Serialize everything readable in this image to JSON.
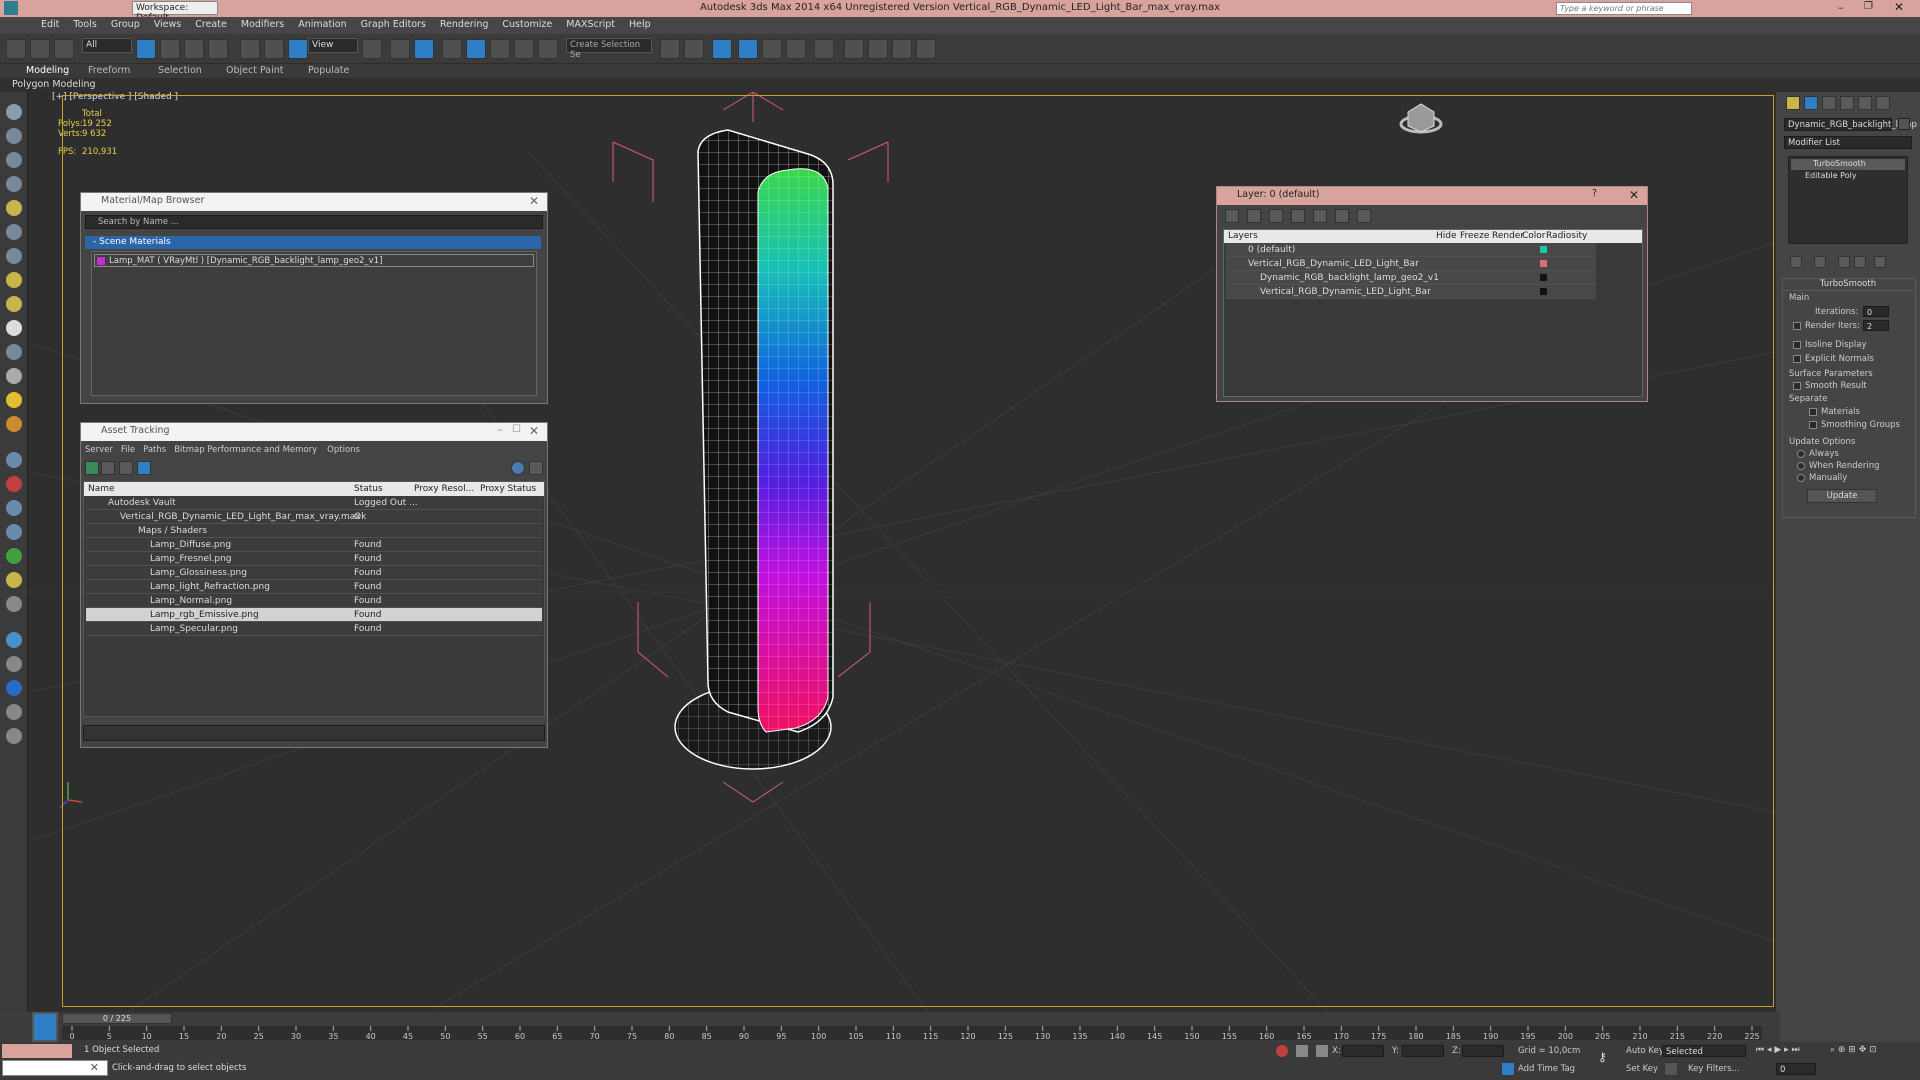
{
  "title": "Autodesk 3ds Max  2014 x64    Unregistered Version    Vertical_RGB_Dynamic_LED_Light_Bar_max_vray.max",
  "quickaccess": {
    "workspace": "Workspace: Default",
    "search_placeholder": "Type a keyword or phrase"
  },
  "menu": [
    "Edit",
    "Tools",
    "Group",
    "Views",
    "Create",
    "Modifiers",
    "Animation",
    "Graph Editors",
    "Rendering",
    "Customize",
    "MAXScript",
    "Help"
  ],
  "toolbar": {
    "filter": "All",
    "refcoord": "View",
    "selset": "Create Selection Se"
  },
  "ribbon": {
    "tabs": [
      "Modeling",
      "Freeform",
      "Selection",
      "Object Paint",
      "Populate"
    ],
    "sub": "Polygon Modeling"
  },
  "viewport": {
    "label": "[+] [Perspective ] [Shaded ]",
    "stats": {
      "total": "Total",
      "polys_label": "Polys:",
      "polys": "19 252",
      "verts_label": "Verts:",
      "verts": "9 632",
      "fps_label": "FPS:",
      "fps": "210,931"
    }
  },
  "material_browser": {
    "title": "Material/Map Browser",
    "search": "Search by Name ...",
    "group": "- Scene Materials",
    "item": "Lamp_MAT  ( VRayMtl )  [Dynamic_RGB_backlight_lamp_geo2_v1]"
  },
  "asset_tracking": {
    "title": "Asset Tracking",
    "menu": [
      "Server",
      "File",
      "Paths",
      "Bitmap Performance and Memory",
      "Options"
    ],
    "columns": [
      "Name",
      "Status",
      "Proxy Resol...",
      "Proxy Status"
    ],
    "rows": [
      {
        "name": "Autodesk Vault",
        "status": "Logged Out ..."
      },
      {
        "name": "Vertical_RGB_Dynamic_LED_Light_Bar_max_vray.max",
        "status": "Ok"
      },
      {
        "name": "Maps / Shaders",
        "status": ""
      },
      {
        "name": "Lamp_Diffuse.png",
        "status": "Found"
      },
      {
        "name": "Lamp_Fresnel.png",
        "status": "Found"
      },
      {
        "name": "Lamp_Glossiness.png",
        "status": "Found"
      },
      {
        "name": "Lamp_light_Refraction.png",
        "status": "Found"
      },
      {
        "name": "Lamp_Normal.png",
        "status": "Found"
      },
      {
        "name": "Lamp_rgb_Emissive.png",
        "status": "Found"
      },
      {
        "name": "Lamp_Specular.png",
        "status": "Found"
      }
    ]
  },
  "layers": {
    "title": "Layer: 0 (default)",
    "columns": [
      "Layers",
      "Hide",
      "Freeze",
      "Render",
      "Color",
      "Radiosity"
    ],
    "rows": [
      {
        "name": "0 (default)",
        "color": "#1fc7a8"
      },
      {
        "name": "Vertical_RGB_Dynamic_LED_Light_Bar",
        "color": "#e06a7a"
      },
      {
        "name": "Dynamic_RGB_backlight_lamp_geo2_v1",
        "color": "#111111"
      },
      {
        "name": "Vertical_RGB_Dynamic_LED_Light_Bar",
        "color": "#111111"
      }
    ]
  },
  "cmdpanel": {
    "object_name": "Dynamic_RGB_backlight_lamp",
    "modifier_list": "Modifier List",
    "stack": [
      "TurboSmooth",
      "Editable Poly"
    ],
    "rollout": "TurboSmooth",
    "main": "Main",
    "iterations_label": "Iterations:",
    "iterations": "0",
    "render_iters_label": "Render Iters:",
    "render_iters": "2",
    "isoline": "Isoline Display",
    "explicit": "Explicit Normals",
    "surface": "Surface Parameters",
    "smooth": "Smooth Result",
    "separate": "Separate",
    "materials": "Materials",
    "smoothing": "Smoothing Groups",
    "update_options": "Update Options",
    "always": "Always",
    "when_rendering": "When Rendering",
    "manually": "Manually",
    "update": "Update"
  },
  "timeline": {
    "frame": "0 / 225",
    "ticks": [
      "0",
      "5",
      "10",
      "15",
      "20",
      "25",
      "30",
      "35",
      "40",
      "45",
      "50",
      "55",
      "60",
      "65",
      "70",
      "75",
      "80",
      "85",
      "90",
      "95",
      "100",
      "105",
      "110",
      "115",
      "120",
      "125",
      "130",
      "135",
      "140",
      "145",
      "150",
      "155",
      "160",
      "165",
      "170",
      "175",
      "180",
      "185",
      "190",
      "195",
      "200",
      "205",
      "210",
      "215",
      "220",
      "225"
    ]
  },
  "status": {
    "selected": "1 Object Selected",
    "prompt": "Click-and-drag to select objects",
    "x": "X:",
    "y": "Y:",
    "z": "Z:",
    "grid": "Grid = 10,0cm",
    "autokey": "Auto Key",
    "selected_dd": "Selected",
    "setkey": "Set Key",
    "keyfilters": "Key Filters...",
    "addtime": "Add Time Tag",
    "frame": "0"
  }
}
